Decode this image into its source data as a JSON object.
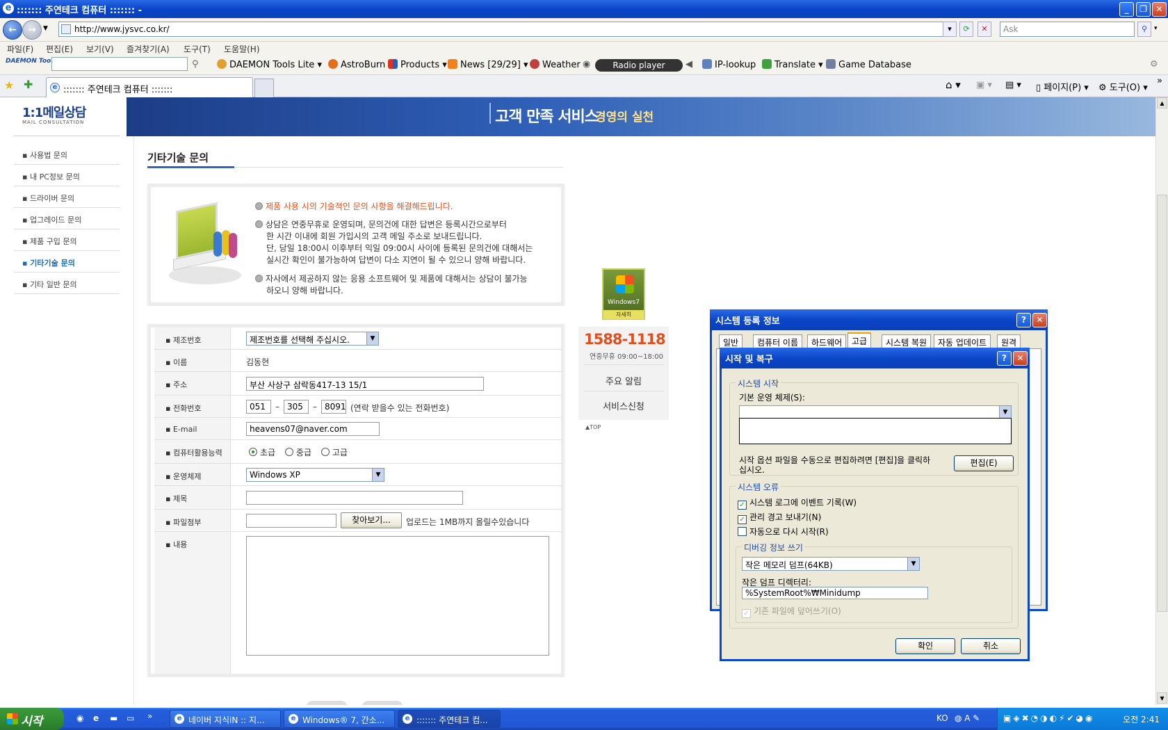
{
  "window": {
    "title": "::::::: 주연테크 컴퓨터 ::::::: -"
  },
  "nav": {
    "url": "http://www.jysvc.co.kr/",
    "search_placeholder": "Ask"
  },
  "menubar": [
    "파일(F)",
    "편집(E)",
    "보기(V)",
    "즐겨찾기(A)",
    "도구(T)",
    "도움말(H)"
  ],
  "toolbar": {
    "daemon_logo": "DAEMON Tools",
    "daemon_lite": "DAEMON Tools Lite",
    "astroburn": "AstroBurn",
    "products": "Products",
    "news": "News [29/29]",
    "weather": "Weather",
    "radio": "Radio player",
    "iplookup": "IP-lookup",
    "translate": "Translate",
    "gamedb": "Game Database"
  },
  "tabs": {
    "active": "::::::: 주연테크 컴퓨터 :::::::",
    "page_menu": "페이지(P)",
    "tools_menu": "도구(O)"
  },
  "site": {
    "logo": "1:1메일상담",
    "logo_sub": "MAIL CONSULTATION",
    "banner_main": "고객 만족 서비스",
    "banner_sub": "경영의 실천",
    "leftnav": [
      "사용법 문의",
      "내 PC정보 문의",
      "드라이버 문의",
      "업그레이드 문의",
      "제품 구입 문의",
      "기타기술 문의",
      "기타 일반 문의"
    ],
    "page_title": "기타기술 문의",
    "info_line1": "제품 사용 시의 기술적인 문의 사항을 해결해드립니다.",
    "info_line2": [
      "상담은 연중무휴로 운영되며, 문의건에 대한 답변은 등록시간으로부터",
      "한 시간 이내에 회원 가입시의 고객 메일 주소로 보내드립니다.",
      "단, 당일 18:00시 이후부터 익일 09:00시 사이에 등록된 문의건에 대해서는",
      "실시간 확인이 불가능하여 답변이 다소 지연이 될 수 있으니 양해 바랍니다."
    ],
    "info_line3": [
      "자사에서 제공하지 않는 응용 소프트웨어 및 제품에 대해서는 상담이 불가능",
      "하오니 양해 바랍니다."
    ],
    "form": {
      "labels": [
        "제조번호",
        "이름",
        "주소",
        "전화번호",
        "E-mail",
        "컴퓨터활용능력",
        "운영체제",
        "제목",
        "파일첨부",
        "내용"
      ],
      "serial_select": "제조번호를 선택해 주십시오.",
      "name": "김동현",
      "address": "부산 사상구 삼락동417-13 15/1",
      "phone1": "051",
      "phone2": "305",
      "phone3": "8091",
      "phone_dash": "–",
      "phone_note": "(연락 받을수 있는 전화번호)",
      "email": "heavens07@naver.com",
      "skill_options": [
        "초급",
        "중급",
        "고급"
      ],
      "skill_selected": "초급",
      "os": "Windows XP",
      "browse_btn": "찾아보기...",
      "upload_note": "업로드는 1MB까지 올릴수있습니다"
    },
    "win7_badge": "Windows7",
    "win7_more": "자세히",
    "phone_number": "1588-1118",
    "phone_hours": "연중무휴 09:00~18:00",
    "notice": "주요 알림",
    "service": "서비스신청",
    "top_link": "▲TOP"
  },
  "sysdlg": {
    "title": "시스템 등록 정보",
    "tabs": [
      "일반",
      "컴퓨터 이름",
      "하드웨어",
      "고급",
      "시스템 복원",
      "자동 업데이트",
      "원격"
    ],
    "active_tab": "고급"
  },
  "startupdlg": {
    "title": "시작 및 복구",
    "group_start": "시스템 시작",
    "default_os_label": "기본 운영 체제(S):",
    "edit_note": "시작 옵션 파일을 수동으로 편집하려면 [편집]을 클릭하십시오.",
    "edit_btn": "편집(E)",
    "group_error": "시스템 오류",
    "cb_log": "시스템 로그에 이벤트 기록(W)",
    "cb_alert": "관리 경고 보내기(N)",
    "cb_restart": "자동으로 다시 시작(R)",
    "group_debug": "디버깅 정보 쓰기",
    "dump_select": "작은 메모리 덤프(64KB)",
    "dump_dir_label": "작은 덤프 디렉터리:",
    "dump_dir": "%SystemRoot%₩Minidump",
    "overwrite": "기존 파일에 덮어쓰기(O)",
    "ok": "확인",
    "cancel": "취소"
  },
  "taskbar": {
    "start": "시작",
    "items": [
      "네이버 지식iN :: 지...",
      "Windows® 7, 간소...",
      "::::::: 주연테크 컴..."
    ],
    "lang": "KO",
    "clock": "오전 2:41"
  }
}
